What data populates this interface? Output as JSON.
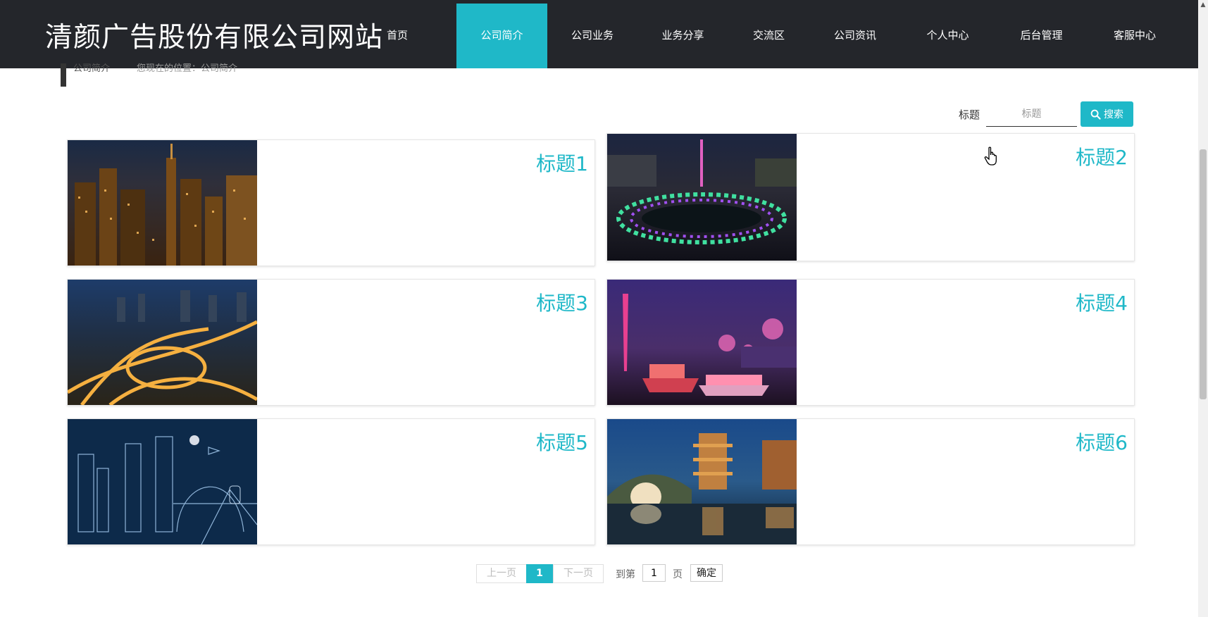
{
  "header": {
    "site_title": "清颜广告股份有限公司网站"
  },
  "nav": {
    "items": [
      {
        "label": "首页"
      },
      {
        "label": "公司简介",
        "active": true
      },
      {
        "label": "公司业务"
      },
      {
        "label": "业务分享"
      },
      {
        "label": "交流区"
      },
      {
        "label": "公司资讯"
      },
      {
        "label": "个人中心"
      },
      {
        "label": "后台管理"
      },
      {
        "label": "客服中心"
      }
    ]
  },
  "breadcrumb": {
    "section": "公司简介",
    "location": "您现在的位置：公司简介"
  },
  "search": {
    "label": "标题",
    "placeholder": "标题",
    "button": "搜索"
  },
  "cards": [
    {
      "title": "标题1",
      "image": "night-city-skyline"
    },
    {
      "title": "标题2",
      "image": "tower-fountain-lights"
    },
    {
      "title": "标题3",
      "image": "highway-interchange-night"
    },
    {
      "title": "标题4",
      "image": "canton-tower-boats"
    },
    {
      "title": "标题5",
      "image": "line-art-city"
    },
    {
      "title": "标题6",
      "image": "pagoda-bridge-reflection"
    }
  ],
  "pagination": {
    "prev": "上一页",
    "current": "1",
    "next": "下一页",
    "goto_label": "到第",
    "goto_value": "1",
    "page_unit": "页",
    "confirm": "确定"
  },
  "colors": {
    "accent": "#1fb8c8",
    "nav_bg": "#24262b"
  }
}
